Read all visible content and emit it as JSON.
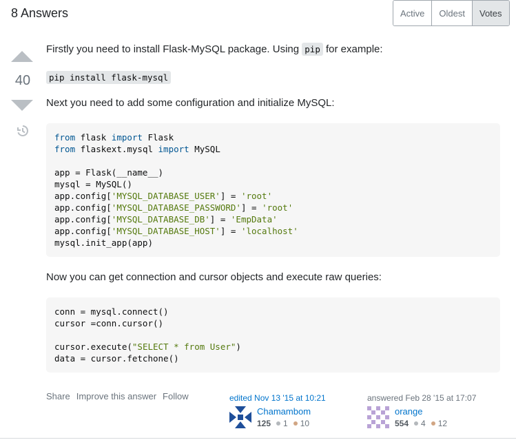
{
  "header": {
    "answers_count_label": "8 Answers"
  },
  "sort_tabs": [
    {
      "label": "Active",
      "selected": false
    },
    {
      "label": "Oldest",
      "selected": false
    },
    {
      "label": "Votes",
      "selected": true
    }
  ],
  "vote": {
    "score": "40",
    "up_icon": "upvote-arrow-icon",
    "down_icon": "downvote-arrow-icon",
    "history_icon": "history-icon"
  },
  "answer": {
    "para1_before": "Firstly you need to install Flask-MySQL package. Using ",
    "para1_code": "pip",
    "para1_after": " for example:",
    "install_code": "pip install flask-mysql",
    "para2": "Next you need to add some configuration and initialize MySQL:",
    "para3": "Now you can get connection and cursor objects and execute raw queries:",
    "code1": {
      "l1_kw1": "from",
      "l1_mid": " flask ",
      "l1_kw2": "import",
      "l1_end": " Flask",
      "l2_kw1": "from",
      "l2_mid": " flaskext.mysql ",
      "l2_kw2": "import",
      "l2_end": " MySQL",
      "l3": "app = Flask(__name__)",
      "l4": "mysql = MySQL()",
      "l5_a": "app.config[",
      "l5_s1": "'MYSQL_DATABASE_USER'",
      "l5_b": "] = ",
      "l5_s2": "'root'",
      "l6_a": "app.config[",
      "l6_s1": "'MYSQL_DATABASE_PASSWORD'",
      "l6_b": "] = ",
      "l6_s2": "'root'",
      "l7_a": "app.config[",
      "l7_s1": "'MYSQL_DATABASE_DB'",
      "l7_b": "] = ",
      "l7_s2": "'EmpData'",
      "l8_a": "app.config[",
      "l8_s1": "'MYSQL_DATABASE_HOST'",
      "l8_b": "] = ",
      "l8_s2": "'localhost'",
      "l9": "mysql.init_app(app)"
    },
    "code2": {
      "l1": "conn = mysql.connect()",
      "l2": "cursor =conn.cursor()",
      "l3_a": "cursor.execute(",
      "l3_s": "\"SELECT * from User\"",
      "l3_b": ")",
      "l4": "data = cursor.fetchone()"
    }
  },
  "menu": {
    "share": "Share",
    "improve": "Improve this answer",
    "follow": "Follow"
  },
  "editor": {
    "action": "edited Nov 13 '15 at 10:21",
    "name": "Chamambom",
    "rep": "125",
    "silver": "1",
    "bronze": "10"
  },
  "author": {
    "action": "answered Feb 28 '15 at 17:07",
    "name": "orange",
    "rep": "554",
    "silver": "4",
    "bronze": "12"
  },
  "colors": {
    "link": "#0074cc",
    "keyword": "#015692",
    "string": "#54790d",
    "code_bg": "#f6f6f6"
  }
}
